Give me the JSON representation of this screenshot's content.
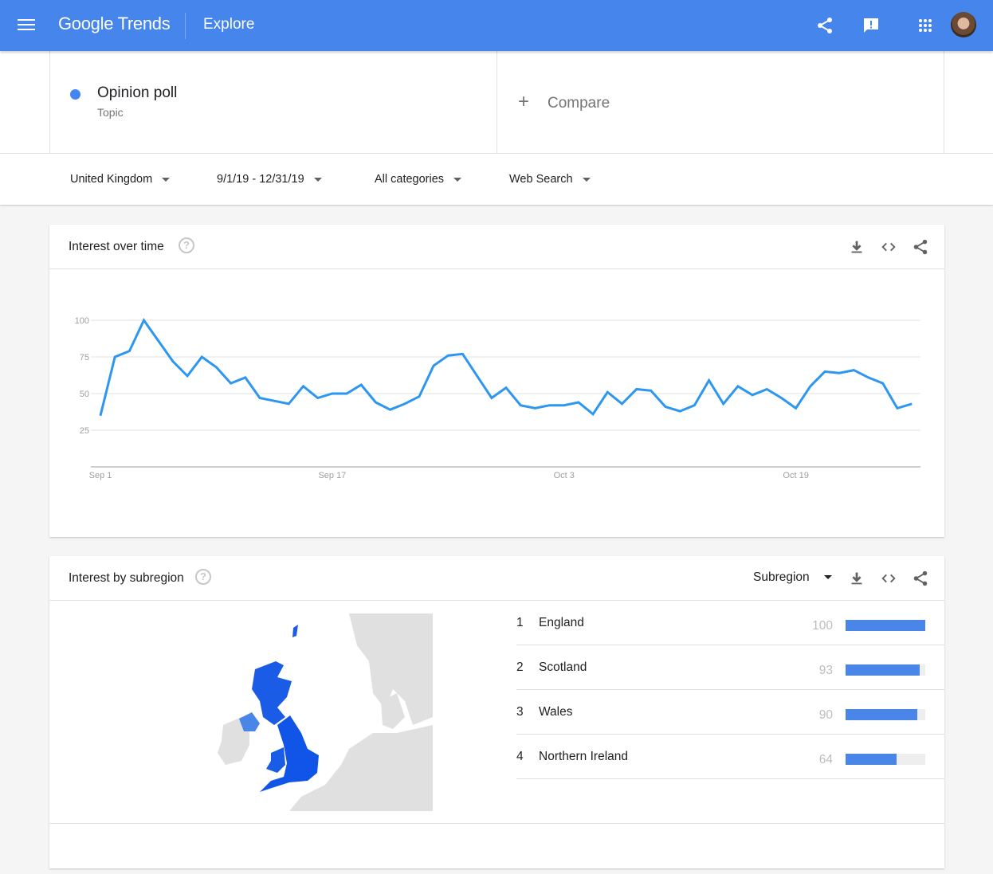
{
  "appbar": {
    "logo_google": "Google",
    "logo_trends": "Trends",
    "section": "Explore",
    "icons": [
      "menu-icon",
      "share-icon",
      "feedback-icon",
      "apps-icon",
      "avatar"
    ]
  },
  "search": {
    "term": "Opinion poll",
    "term_type": "Topic",
    "term_color": "#4285f4",
    "compare_label": "Compare"
  },
  "filters": {
    "region": "United Kingdom",
    "date_range": "9/1/19 - 12/31/19",
    "category": "All categories",
    "search_type": "Web Search"
  },
  "interest_over_time": {
    "title": "Interest over time",
    "help": "?",
    "actions": [
      "download",
      "embed",
      "share"
    ]
  },
  "chart_data": {
    "type": "line",
    "title": "Interest over time",
    "xlabel": "",
    "ylabel": "",
    "ylim": [
      0,
      100
    ],
    "yticks": [
      25,
      50,
      75,
      100
    ],
    "x_tick_labels": [
      "Sep 1",
      "Sep 17",
      "Oct 3",
      "Oct 19"
    ],
    "x_tick_indices": [
      0,
      16,
      32,
      48
    ],
    "grid": true,
    "series": [
      {
        "name": "Opinion poll",
        "color": "#2d96f0",
        "values": [
          35,
          75,
          79,
          100,
          86,
          72,
          62,
          75,
          68,
          57,
          61,
          47,
          45,
          43,
          55,
          47,
          50,
          50,
          56,
          44,
          39,
          43,
          48,
          69,
          76,
          77,
          62,
          47,
          54,
          42,
          40,
          42,
          42,
          44,
          36,
          51,
          43,
          53,
          52,
          41,
          38,
          42,
          59,
          43,
          55,
          49,
          53,
          47,
          40,
          55,
          65,
          64,
          66,
          61,
          57,
          40,
          43
        ]
      }
    ]
  },
  "interest_by_subregion": {
    "title": "Interest by subregion",
    "help": "?",
    "resolution": "Subregion",
    "actions": [
      "download",
      "embed",
      "share"
    ],
    "rows": [
      {
        "rank": "1",
        "name": "England",
        "value": "100",
        "fraction": 1.0
      },
      {
        "rank": "2",
        "name": "Scotland",
        "value": "93",
        "fraction": 0.93
      },
      {
        "rank": "3",
        "name": "Wales",
        "value": "90",
        "fraction": 0.9
      },
      {
        "rank": "4",
        "name": "Northern Ireland",
        "value": "64",
        "fraction": 0.64
      }
    ],
    "map_colors": {
      "high": "#1155e8",
      "mid": "#1a5ce6",
      "low": "#4a86e8",
      "other": "#e0e0e0"
    }
  }
}
